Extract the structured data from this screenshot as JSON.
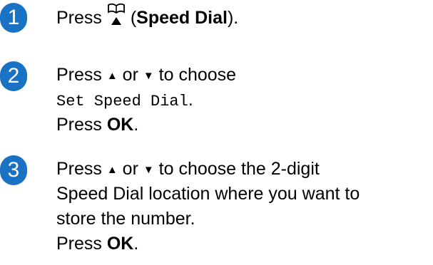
{
  "colors": {
    "step_badge": "#1a72c4",
    "text": "#000000",
    "background": "#ffffff"
  },
  "steps": [
    {
      "number": "1",
      "press": "Press",
      "icon": "speed-dial-book-icon",
      "open_paren": "(",
      "speed_dial": "Speed Dial",
      "close_paren": ")."
    },
    {
      "number": "2",
      "press": "Press",
      "up_arrow": "▲",
      "or": "or",
      "down_arrow": "▼",
      "to_choose": "to choose",
      "menu_option": "Set Speed Dial",
      "menu_period": ".",
      "press_ok_prefix": "Press",
      "ok": "OK",
      "ok_period": "."
    },
    {
      "number": "3",
      "press": "Press",
      "up_arrow": "▲",
      "or": "or",
      "down_arrow": "▼",
      "line1_rest": "to choose the 2-digit",
      "line2": "Speed Dial location where you want to",
      "line3": "store the number.",
      "press_ok_prefix": "Press",
      "ok": "OK",
      "ok_period": "."
    }
  ]
}
